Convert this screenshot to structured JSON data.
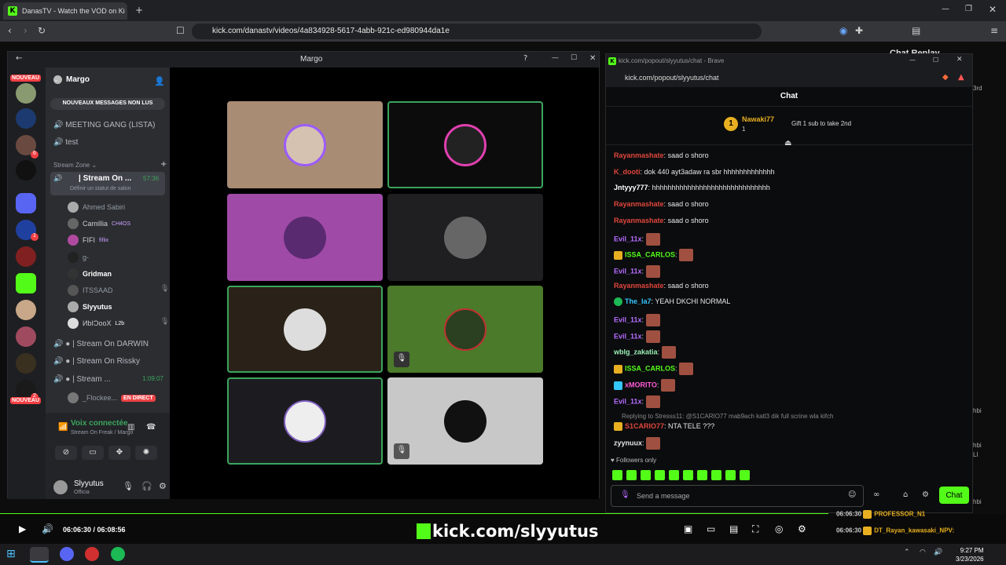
{
  "browser": {
    "tab_title": "DanasTV - Watch the VOD on Ki",
    "url": "kick.com/danastv/videos/4a834928-5617-4abb-921c-ed980944da1e",
    "right_panel_title": "Chat Replay"
  },
  "discord": {
    "window_title": "Margo",
    "server_badge": "NOUVEAU",
    "server_badge2": "NOUVEAU",
    "unread_counts": [
      "6",
      "1",
      "2"
    ],
    "server_name": "Margo",
    "new_messages_btn": "NOUVEAUX MESSAGES NON LUS",
    "channels": [
      "MEETING GANG (LISTA)",
      "test"
    ],
    "category": "Stream Zone",
    "active_channel": {
      "name": "| Stream On ...",
      "time": "57:36",
      "status": "Définir un statut de salon"
    },
    "users": [
      {
        "name": "Ahmed Sabiri",
        "tag": ""
      },
      {
        "name": "Camillia",
        "tag": "CH4OS"
      },
      {
        "name": "FIFI",
        "tag": "fifiix"
      },
      {
        "name": "g-",
        "tag": ""
      },
      {
        "name": "Gridman",
        "tag": ""
      },
      {
        "name": "ITSSAAD",
        "tag": ""
      },
      {
        "name": "Slyyutus",
        "tag": ""
      },
      {
        "name": "ИbIϽooX",
        "tag": "L2b"
      }
    ],
    "channels2": [
      "| Stream On DARWIN",
      "| Stream On Rissky"
    ],
    "channel3": {
      "name": "| Stream ...",
      "time": "1:09:07"
    },
    "live_user": {
      "name": "_Flockee...",
      "badge": "EN DIRECT"
    },
    "voice": {
      "title": "Voix connectée",
      "sub": "Stream On Freak / Margo"
    },
    "me": {
      "name": "Slyyutus",
      "status": "Officia"
    }
  },
  "chat": {
    "window_title": "kick.com/popout/slyyutus/chat - Brave",
    "url": "kick.com/popout/slyyutus/chat",
    "header": "Chat",
    "top_gifter": {
      "name": "Nawaki77",
      "count": "1",
      "rank": "1",
      "cta": "Gift 1 sub to take 2nd"
    },
    "messages": [
      {
        "user": "Rayanmashate",
        "color": "#e0463c",
        "text": "saad o shoro"
      },
      {
        "user": "K_dooti",
        "color": "#e0463c",
        "text": "dok 440 ayt3adaw ra sbr hhhhhhhhhhhhh"
      },
      {
        "user": "Jntyyy777",
        "color": "#ffffff",
        "text": "hhhhhhhhhhhhhhhhhhhhhhhhhhhhhh"
      },
      {
        "user": "Rayanmashate",
        "color": "#e0463c",
        "text": "saad o shoro"
      },
      {
        "user": "Rayanmashate",
        "color": "#e0463c",
        "text": "saad o shoro"
      },
      {
        "user": "Evil_11x",
        "color": "#b56cff",
        "text": ""
      },
      {
        "user": "ISSA_CARLOS",
        "color": "#53fc18",
        "text": ""
      },
      {
        "user": "Evil_11x",
        "color": "#b56cff",
        "text": ""
      },
      {
        "user": "Rayanmashate",
        "color": "#e0463c",
        "text": "saad o shoro"
      },
      {
        "user": "The_la7",
        "color": "#34c6ff",
        "text": "YEAH DKCHI NORMAL"
      },
      {
        "user": "Evil_11x",
        "color": "#b56cff",
        "text": ""
      },
      {
        "user": "Evil_11x",
        "color": "#b56cff",
        "text": ""
      },
      {
        "user": "wblg_zakatia",
        "color": "#9bf0b5",
        "text": ""
      },
      {
        "user": "ISSA_CARLOS",
        "color": "#53fc18",
        "text": ""
      },
      {
        "user": "xMORITO",
        "color": "#ff5ad6",
        "text": ""
      },
      {
        "user": "Evil_11x",
        "color": "#b56cff",
        "text": ""
      }
    ],
    "reply_context": "Replying to Stresss11: @S1CARIO77 mab9ach katl3 dik full scrine wla kifch",
    "reply_msg": {
      "user": "S1CARIO77",
      "color": "#e0463c",
      "text": "NTA TELE ???"
    },
    "last_msg": {
      "user": "zyynuux",
      "color": "#ffffff",
      "text": ""
    },
    "followers_only": "Followers only",
    "input_placeholder": "Send a message",
    "send_label": "Chat"
  },
  "player": {
    "time": "06:06:30 / 06:08:56",
    "overlay": "kick.com/slyyutus"
  },
  "replay_lines": [
    {
      "time": "06:06:30",
      "user": "PROFESSOR_N1"
    },
    {
      "time": "06:06:30",
      "user": "DT_Rayan_kawasaki_NPV:"
    }
  ],
  "replay_side": [
    "hbi",
    "3rd",
    "hbi",
    "hbi",
    "LI"
  ],
  "clock": {
    "time": "9:27 PM",
    "date": "3/23/2026"
  },
  "colors": {
    "kick_green": "#53fc18",
    "discord_bg": "#2b2d31",
    "chat_bg": "#0b0c0e"
  }
}
